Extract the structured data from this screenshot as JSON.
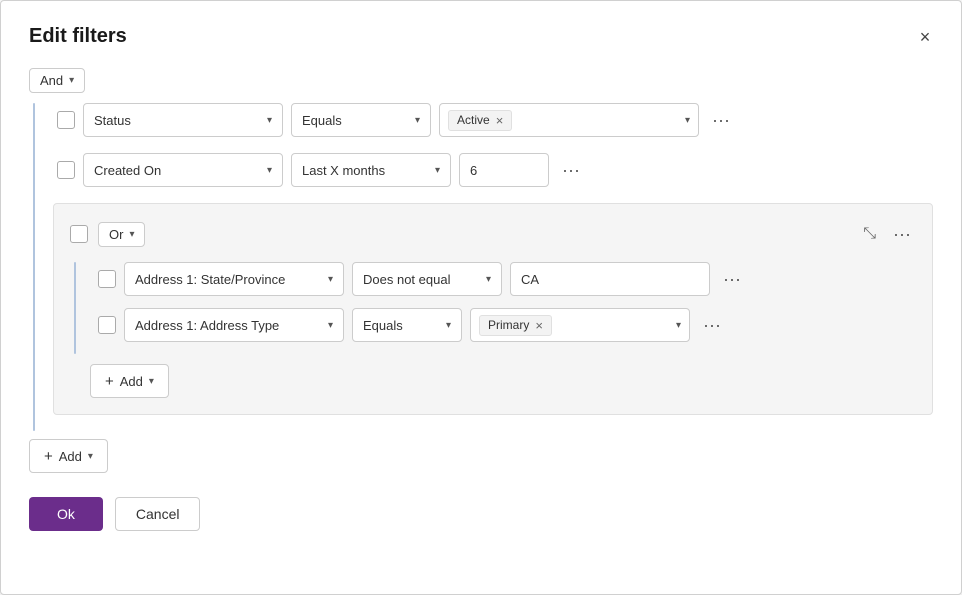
{
  "dialog": {
    "title": "Edit filters",
    "close_label": "×"
  },
  "and_group": {
    "label": "And",
    "chevron": "▾"
  },
  "row1": {
    "field": "Status",
    "operator": "Equals",
    "value_tag": "Active",
    "more": "···"
  },
  "row2": {
    "field": "Created On",
    "operator": "Last X months",
    "value": "6",
    "more": "···"
  },
  "or_group": {
    "label": "Or",
    "chevron": "▾",
    "collapse_icon": "⤡",
    "more": "···",
    "row1": {
      "field": "Address 1: State/Province",
      "operator": "Does not equal",
      "value": "CA",
      "more": "···"
    },
    "row2": {
      "field": "Address 1: Address Type",
      "operator": "Equals",
      "value_tag": "Primary",
      "more": "···"
    },
    "add_label": "Add",
    "add_chevron": "▾"
  },
  "bottom_add": {
    "label": "Add",
    "chevron": "▾"
  },
  "footer": {
    "ok_label": "Ok",
    "cancel_label": "Cancel"
  }
}
